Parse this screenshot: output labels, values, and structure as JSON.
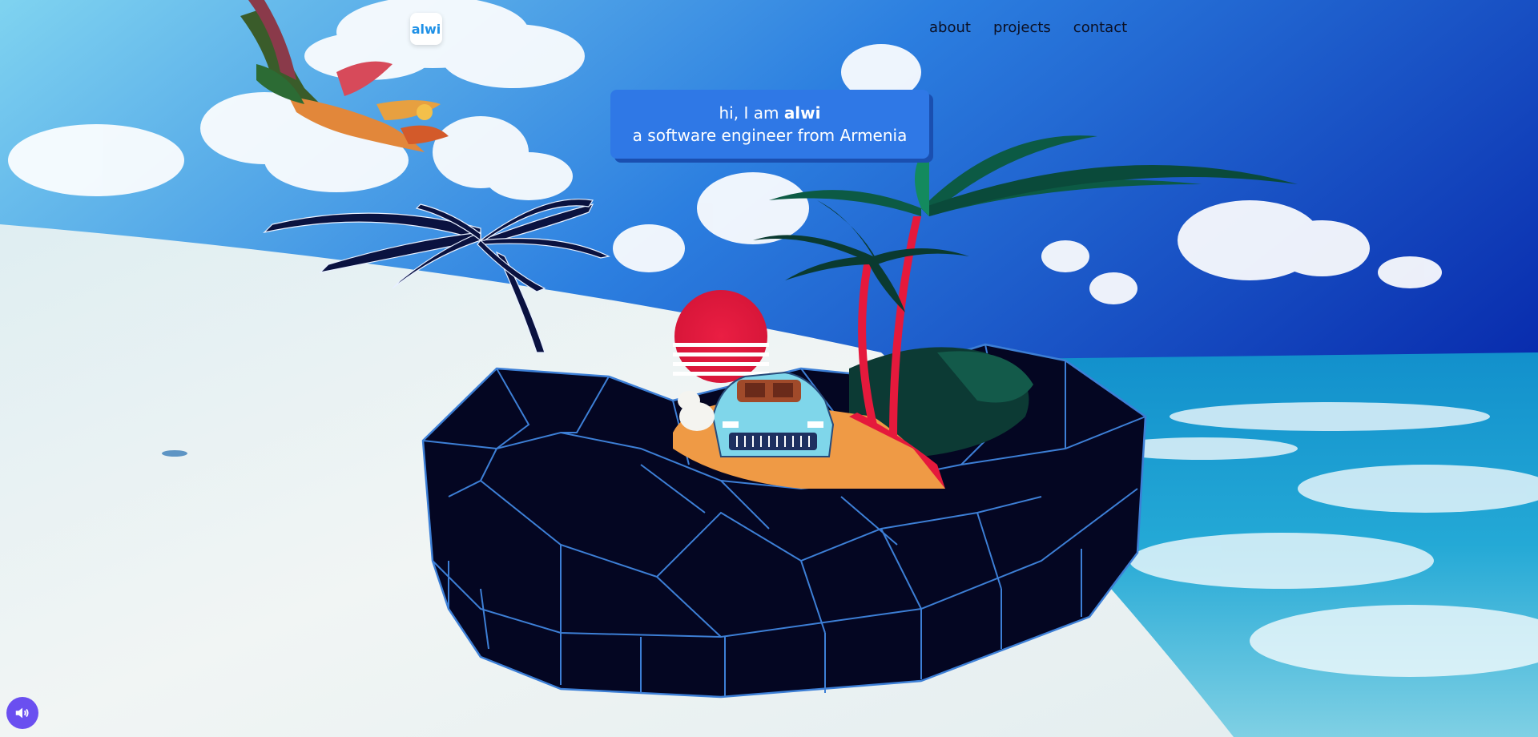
{
  "nav": {
    "logo": "alwi",
    "links": [
      "about",
      "projects",
      "contact"
    ]
  },
  "hero": {
    "greeting_prefix": "hi, I am ",
    "name": "alwi",
    "tagline": "a software engineer from Armenia"
  },
  "controls": {
    "sound_icon": "speaker-icon"
  },
  "colors": {
    "sky": "#0a2ea8",
    "card": "#2f78e6",
    "accent_sun": "#e5193c",
    "island": "#040622",
    "wireframe": "#3d7fd6",
    "sound_button": "#6a4ff0"
  }
}
